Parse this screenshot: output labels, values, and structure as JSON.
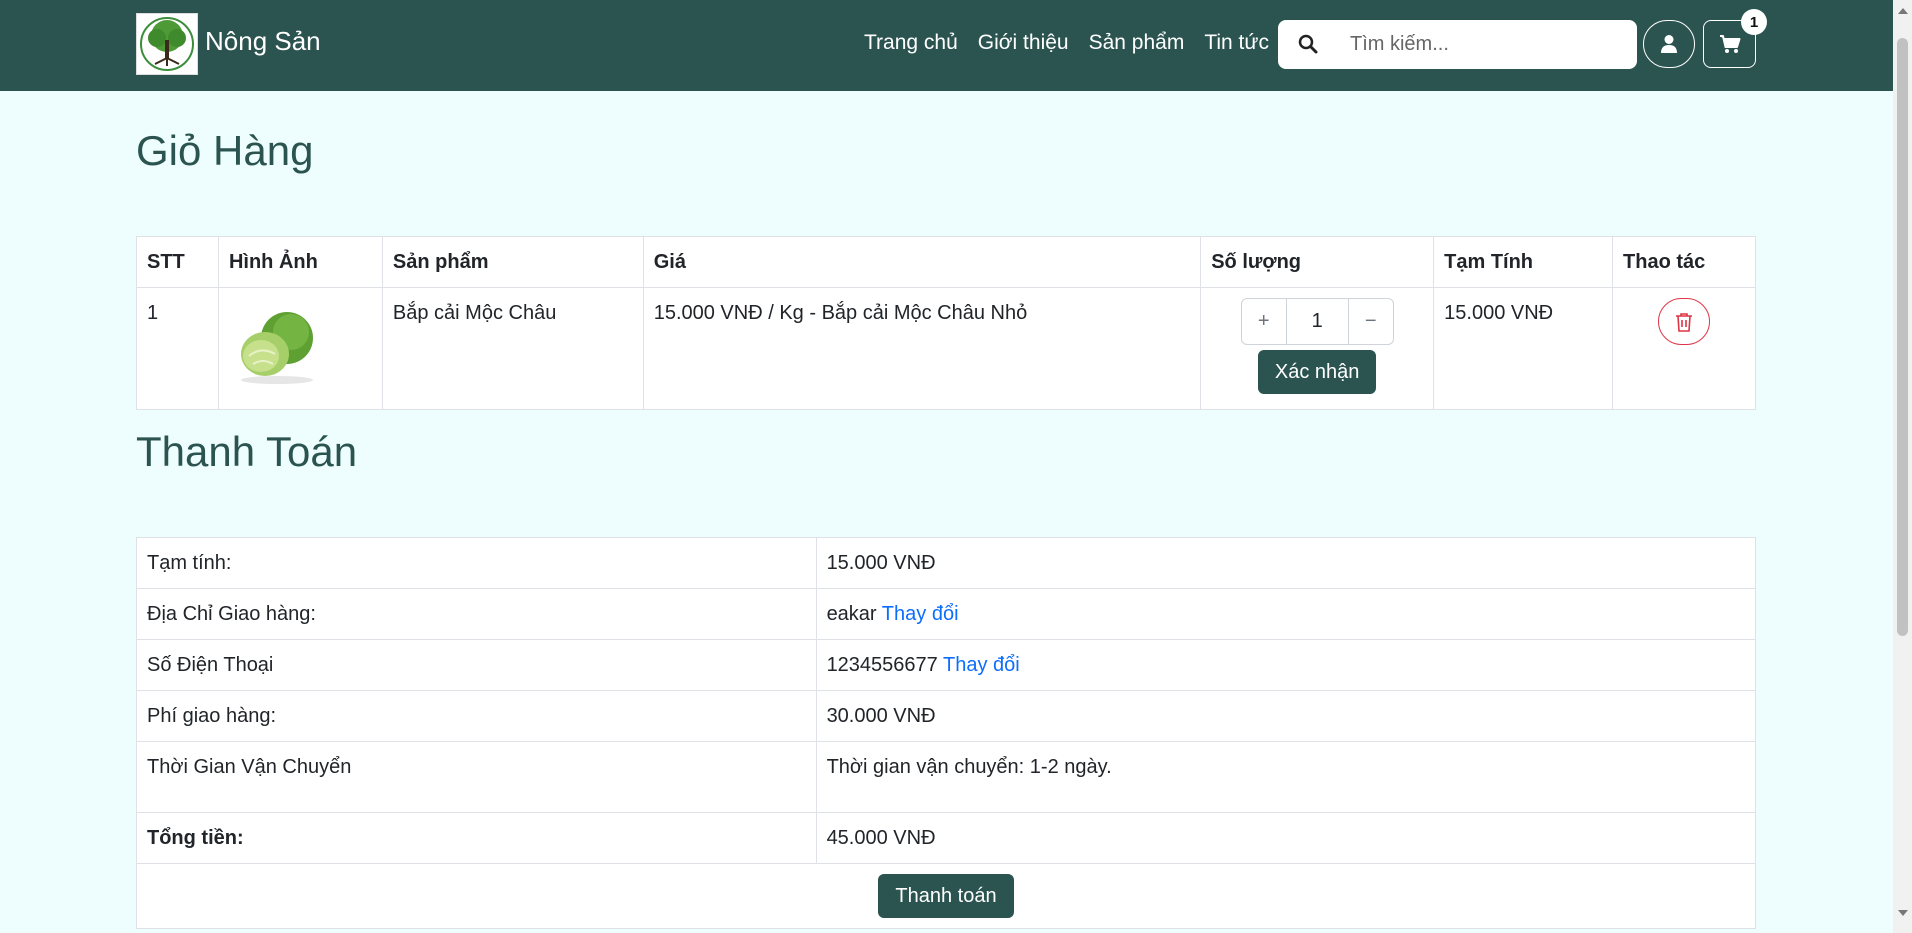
{
  "brand": {
    "name": "Nông Sản"
  },
  "nav": {
    "items": [
      "Trang chủ",
      "Giới thiệu",
      "Sản phẩm",
      "Tin tức"
    ]
  },
  "search": {
    "placeholder": "Tìm kiếm..."
  },
  "cart_badge": "1",
  "cart": {
    "title": "Giỏ Hàng",
    "headers": [
      "STT",
      "Hình Ảnh",
      "Sản phẩm",
      "Giá",
      "Số lượng",
      "Tạm Tính",
      "Thao tác"
    ],
    "rows": [
      {
        "index": "1",
        "product": "Bắp cải Mộc Châu",
        "price": "15.000 VNĐ / Kg - Bắp cải Mộc Châu Nhỏ",
        "quantity": "1",
        "subtotal": "15.000 VNĐ",
        "plus": "+",
        "minus": "−",
        "confirm": "Xác nhận"
      }
    ]
  },
  "payment": {
    "title": "Thanh Toán",
    "subtotal_label": "Tạm tính:",
    "subtotal_value": "15.000 VNĐ",
    "address_label": "Địa Chỉ Giao hàng:",
    "address_value": "eakar",
    "phone_label": "Số Điện Thoại",
    "phone_value": "1234556677",
    "change_link": "Thay đổi",
    "shipping_label": "Phí giao hàng:",
    "shipping_value": "30.000 VNĐ",
    "time_label": "Thời Gian Vận Chuyển",
    "time_value": "Thời gian vận chuyển: 1-2 ngày.",
    "total_label": "Tổng tiền:",
    "total_value": "45.000 VNĐ",
    "pay_button": "Thanh toán"
  },
  "colors": {
    "primary": "#2b5450",
    "background": "#eefefe",
    "link": "#0d6efd",
    "danger": "#dc3545"
  }
}
